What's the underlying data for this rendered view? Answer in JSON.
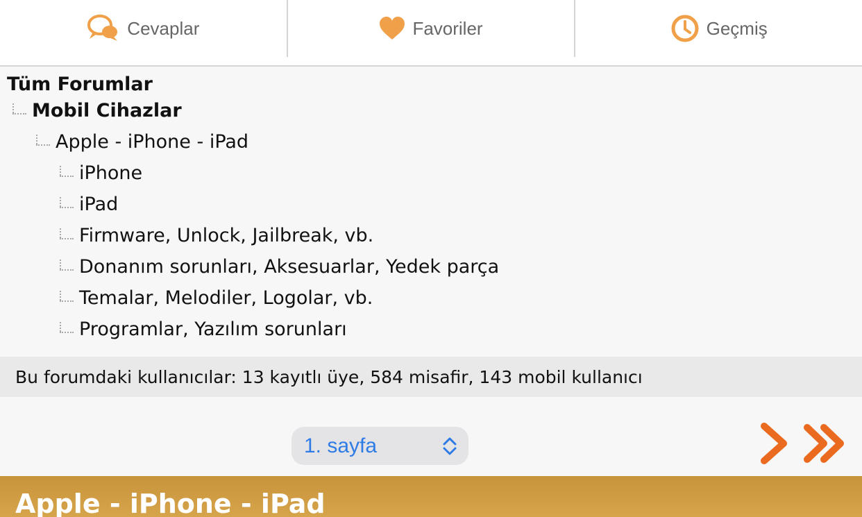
{
  "nav": {
    "tabs": [
      {
        "label": "Cevaplar",
        "icon": "speech-bubbles-icon"
      },
      {
        "label": "Favoriler",
        "icon": "heart-icon"
      },
      {
        "label": "Geçmiş",
        "icon": "clock-icon"
      }
    ],
    "accent_color": "#f0a048"
  },
  "tree": {
    "root": "Tüm Forumlar",
    "category": "Mobil Cihazlar",
    "forum": "Apple - iPhone - iPad",
    "subforums": [
      "iPhone",
      "iPad",
      "Firmware, Unlock, Jailbreak, vb.",
      "Donanım sorunları, Aksesuarlar, Yedek parça",
      "Temalar, Melodiler, Logolar, vb.",
      "Programlar, Yazılım sorunları"
    ]
  },
  "users_text": "Bu forumdaki kullanıcılar: 13 kayıtlı üye, 584 misafir, 143 mobil kullanıcı",
  "pager": {
    "selected": "1. sayfa",
    "next_icon": "chevron-right-icon",
    "last_icon": "double-chevron-right-icon",
    "arrow_color": "#ea6a1f"
  },
  "forum_header": {
    "title": "Apple - iPhone - iPad",
    "bg_color": "#c8943b"
  }
}
